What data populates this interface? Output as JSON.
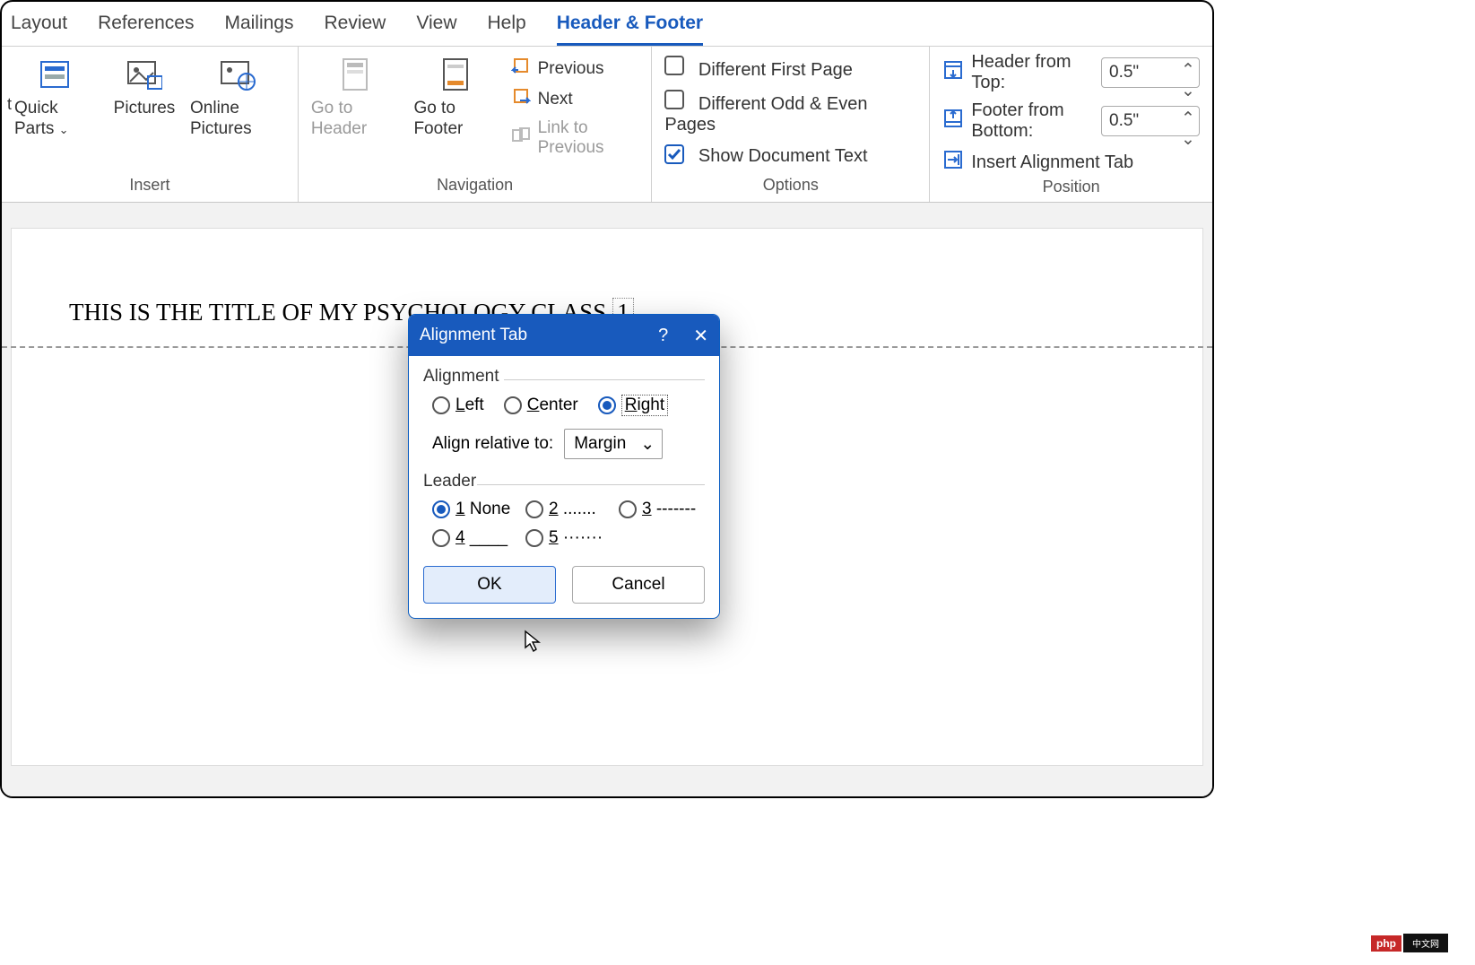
{
  "tabs": {
    "layout": "Layout",
    "references": "References",
    "mailings": "Mailings",
    "review": "Review",
    "view": "View",
    "help": "Help",
    "headerfooter": "Header & Footer"
  },
  "ribbon": {
    "insert_group": "Insert",
    "quick_parts": "Quick Parts",
    "quick_parts_prefix": "t",
    "pictures": "Pictures",
    "online_pictures": "Online Pictures",
    "nav_group": "Navigation",
    "goto_header": "Go to Header",
    "goto_footer": "Go to Footer",
    "previous": "Previous",
    "next": "Next",
    "link_prev": "Link to Previous",
    "options_group": "Options",
    "diff_first": "Different First Page",
    "diff_odd_even": "Different Odd & Even Pages",
    "show_doc_text": "Show Document Text",
    "position_group": "Position",
    "header_from_top": "Header from Top:",
    "header_from_top_val": "0.5\"",
    "footer_from_bottom": "Footer from Bottom:",
    "footer_from_bottom_val": "0.5\"",
    "insert_align_tab": "Insert Alignment Tab"
  },
  "document": {
    "header_text": "THIS IS THE TITLE OF MY PSYCHOLOGY CLASS",
    "page_number": "1"
  },
  "dialog": {
    "title": "Alignment Tab",
    "alignment_label": "Alignment",
    "left": "Left",
    "center": "Center",
    "right": "Right",
    "align_relative": "Align relative to:",
    "align_relative_val": "Margin",
    "leader_label": "Leader",
    "l1": "1 None",
    "l2": "2 .......",
    "l3": "3 -------",
    "l4": "4 ____",
    "l5": "5 ·······",
    "ok": "OK",
    "cancel": "Cancel"
  },
  "badge": {
    "php": "php"
  }
}
